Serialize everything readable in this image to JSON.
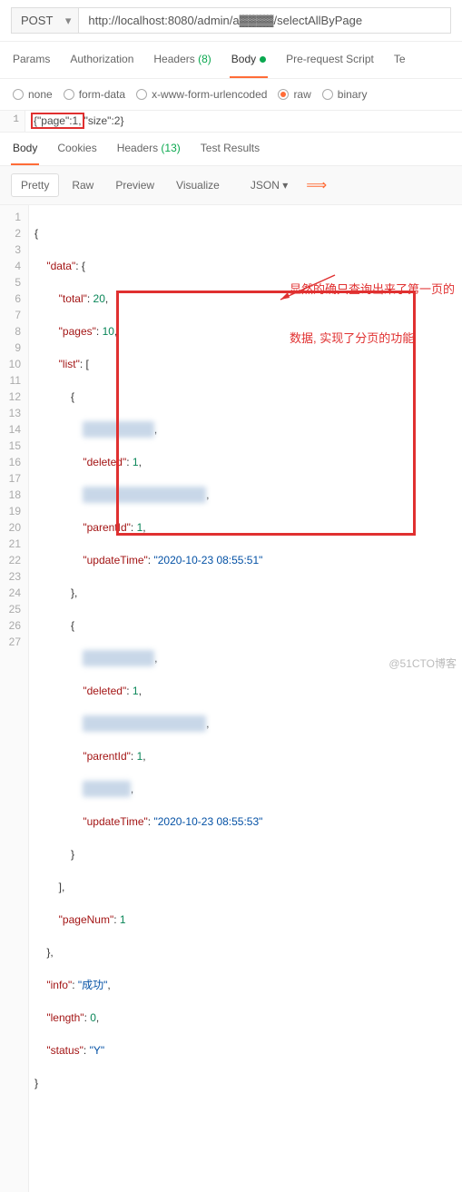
{
  "request": {
    "method": "POST",
    "url": "http://localhost:8080/admin/a▓▓▓▓/selectAllByPage"
  },
  "mainTabs": {
    "params": "Params",
    "auth": "Authorization",
    "headers": "Headers",
    "headers_count": "(8)",
    "body": "Body",
    "prerequest": "Pre-request Script",
    "tests": "Te"
  },
  "bodyTypes": {
    "none": "none",
    "formdata": "form-data",
    "xwww": "x-www-form-urlencoded",
    "raw": "raw",
    "binary": "binary"
  },
  "reqBody": {
    "lineNo": "1",
    "highlight": "{\"page\":1,",
    "rest": "\"size\":2}"
  },
  "responseTabs": {
    "body": "Body",
    "cookies": "Cookies",
    "headers": "Headers",
    "headers_count": "(13)",
    "tests": "Test Results"
  },
  "viewBar": {
    "pretty": "Pretty",
    "raw": "Raw",
    "preview": "Preview",
    "visualize": "Visualize",
    "format": "JSON"
  },
  "json": {
    "l1": "{",
    "l2_k": "\"data\"",
    "l2_r": ": {",
    "l3_k": "\"total\"",
    "l3_v": "20",
    "l4_k": "\"pages\"",
    "l4_v": "10",
    "l5_k": "\"list\"",
    "l5_r": ": [",
    "l6": "{",
    "l7_blur": "\"▓▓▓▓▓▓▓▓\"",
    "l8_k": "\"deleted\"",
    "l8_v": "1",
    "l9_blur": "▓▓▓▓▓  ▓▓▓▓▓▓▓  ▓▓",
    "l10_k": "\"parentId\"",
    "l10_v": "1",
    "l11_k": "\"updateTime\"",
    "l11_v": "\"2020-10-23 08:55:51\"",
    "l12": "},",
    "l13": "{",
    "l14_blur": "▓▓▓▓▓▓▓▓▓",
    "l15_k": "\"deleted\"",
    "l15_v": "1",
    "l16_blur": "▓▓▓▓▓  ▓▓▓▓▓▓▓  ▓▓",
    "l17_k": "\"parentId\"",
    "l17_v": "1",
    "l18_blur": "▓▓▓▓▓▓",
    "l19_k": "\"updateTime\"",
    "l19_v": "\"2020-10-23 08:55:53\"",
    "l20": "}",
    "l21": "],",
    "l22_k": "\"pageNum\"",
    "l22_v": "1",
    "l23": "},",
    "l24_k": "\"info\"",
    "l24_v": "\"成功\"",
    "l25_k": "\"length\"",
    "l25_v": "0",
    "l26_k": "\"status\"",
    "l26_v": "\"Y\"",
    "l27": "}"
  },
  "annotation": {
    "line1": "显然的确只查询出来了第一页的",
    "line2": "数据, 实现了分页的功能"
  },
  "watermark": "@51CTO博客"
}
